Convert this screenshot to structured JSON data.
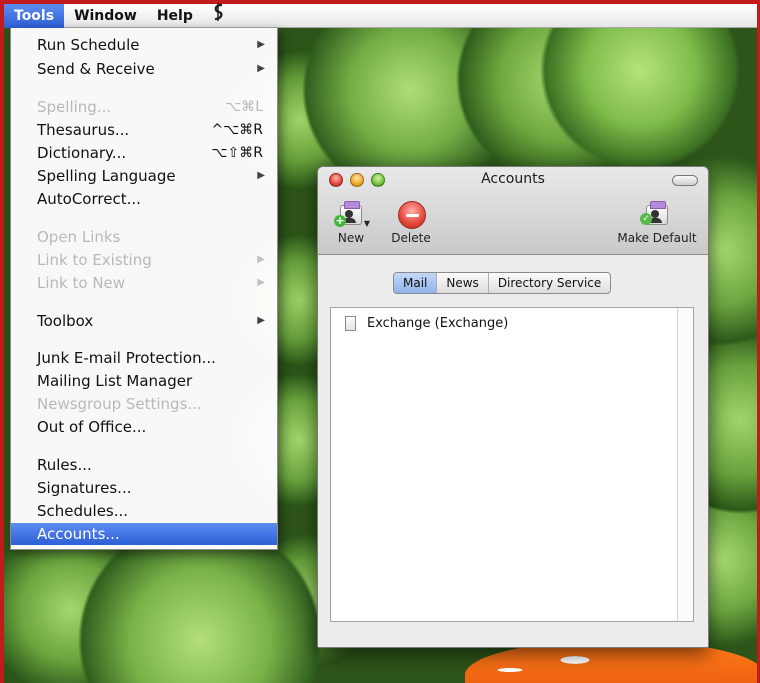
{
  "menubar": {
    "items": [
      {
        "label": "Tools",
        "active": true
      },
      {
        "label": "Window",
        "active": false
      },
      {
        "label": "Help",
        "active": false
      }
    ],
    "script_glyph": "$"
  },
  "tools_menu": {
    "items": [
      {
        "label": "Run Schedule",
        "shortcut": "",
        "submenu": true,
        "disabled": false
      },
      {
        "label": "Send & Receive",
        "shortcut": "",
        "submenu": true,
        "disabled": false
      },
      {
        "label": "Spelling...",
        "shortcut": "⌥⌘L",
        "submenu": false,
        "disabled": true
      },
      {
        "label": "Thesaurus...",
        "shortcut": "^⌥⌘R",
        "submenu": false,
        "disabled": false
      },
      {
        "label": "Dictionary...",
        "shortcut": "⌥⇧⌘R",
        "submenu": false,
        "disabled": false
      },
      {
        "label": "Spelling Language",
        "shortcut": "",
        "submenu": true,
        "disabled": false
      },
      {
        "label": "AutoCorrect...",
        "shortcut": "",
        "submenu": false,
        "disabled": false
      },
      {
        "label": "Open Links",
        "shortcut": "",
        "submenu": false,
        "disabled": true
      },
      {
        "label": "Link to Existing",
        "shortcut": "",
        "submenu": true,
        "disabled": true
      },
      {
        "label": "Link to New",
        "shortcut": "",
        "submenu": true,
        "disabled": true
      },
      {
        "label": "Toolbox",
        "shortcut": "",
        "submenu": true,
        "disabled": false
      },
      {
        "label": "Junk E-mail Protection...",
        "shortcut": "",
        "submenu": false,
        "disabled": false
      },
      {
        "label": "Mailing List Manager",
        "shortcut": "",
        "submenu": false,
        "disabled": false
      },
      {
        "label": "Newsgroup Settings...",
        "shortcut": "",
        "submenu": false,
        "disabled": true
      },
      {
        "label": "Out of Office...",
        "shortcut": "",
        "submenu": false,
        "disabled": false
      },
      {
        "label": "Rules...",
        "shortcut": "",
        "submenu": false,
        "disabled": false
      },
      {
        "label": "Signatures...",
        "shortcut": "",
        "submenu": false,
        "disabled": false
      },
      {
        "label": "Schedules...",
        "shortcut": "",
        "submenu": false,
        "disabled": false
      },
      {
        "label": "Accounts...",
        "shortcut": "",
        "submenu": false,
        "disabled": false,
        "selected": true
      }
    ],
    "submenu_glyph": "▶"
  },
  "accounts_window": {
    "title": "Accounts",
    "toolbar": {
      "new_label": "New",
      "delete_label": "Delete",
      "make_default_label": "Make Default"
    },
    "tabs": [
      {
        "label": "Mail",
        "active": true
      },
      {
        "label": "News",
        "active": false
      },
      {
        "label": "Directory Service",
        "active": false
      }
    ],
    "accounts": [
      {
        "name": "Exchange (Exchange)"
      }
    ]
  },
  "colors": {
    "selection": "#2d5fd6",
    "close": "#e0463a",
    "minimize": "#f1a92b",
    "zoom": "#6fc33a"
  },
  "icons": {
    "new": "new-account-icon",
    "delete": "delete-icon",
    "make_default": "make-default-icon",
    "account_row": "account-document-icon"
  }
}
